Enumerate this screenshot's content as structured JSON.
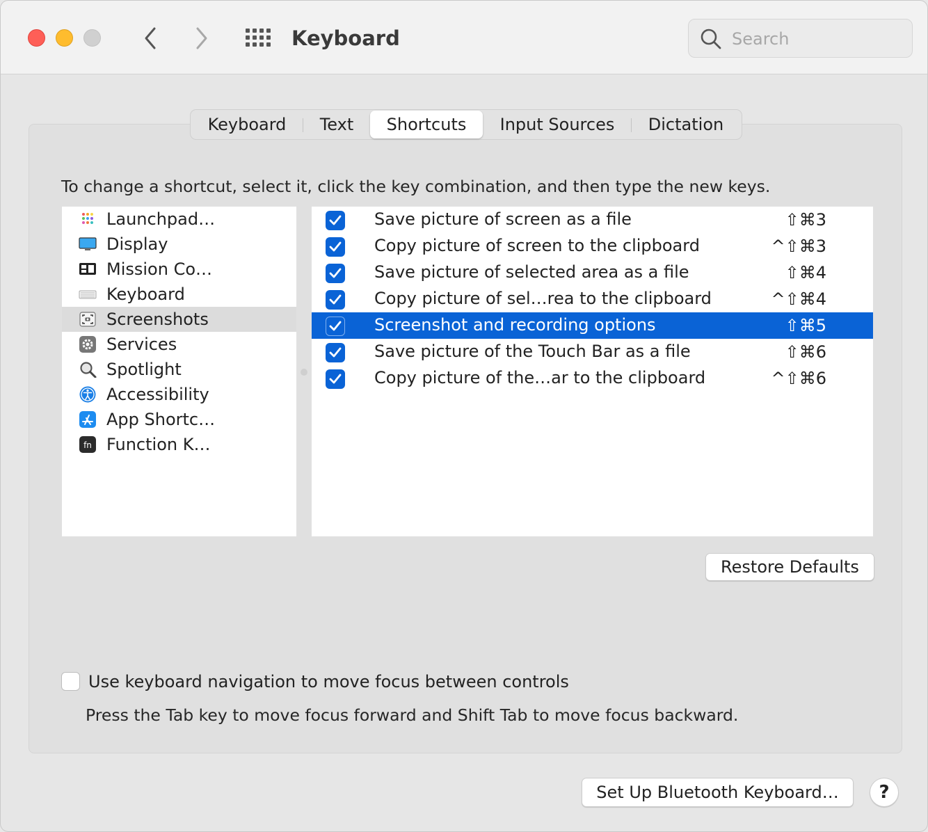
{
  "window": {
    "title": "Keyboard",
    "search_placeholder": "Search"
  },
  "tabs": [
    {
      "label": "Keyboard",
      "active": false
    },
    {
      "label": "Text",
      "active": false
    },
    {
      "label": "Shortcuts",
      "active": true
    },
    {
      "label": "Input Sources",
      "active": false
    },
    {
      "label": "Dictation",
      "active": false
    }
  ],
  "instructions": "To change a shortcut, select it, click the key combination, and then type the new keys.",
  "categories": [
    {
      "label": "Launchpad…",
      "icon": "launchpad-icon",
      "selected": false
    },
    {
      "label": "Display",
      "icon": "display-icon",
      "selected": false
    },
    {
      "label": "Mission Co…",
      "icon": "mission-control-icon",
      "selected": false
    },
    {
      "label": "Keyboard",
      "icon": "keyboard-icon",
      "selected": false
    },
    {
      "label": "Screenshots",
      "icon": "screenshot-icon",
      "selected": true
    },
    {
      "label": "Services",
      "icon": "gear-icon",
      "selected": false
    },
    {
      "label": "Spotlight",
      "icon": "magnifier-icon",
      "selected": false
    },
    {
      "label": "Accessibility",
      "icon": "accessibility-icon",
      "selected": false
    },
    {
      "label": "App Shortc…",
      "icon": "app-store-icon",
      "selected": false
    },
    {
      "label": "Function K…",
      "icon": "fn-key-icon",
      "selected": false
    }
  ],
  "shortcuts": [
    {
      "label": "Save picture of screen as a file",
      "keys": "⇧⌘3",
      "checked": true,
      "selected": false
    },
    {
      "label": "Copy picture of screen to the clipboard",
      "keys": "^⇧⌘3",
      "checked": true,
      "selected": false
    },
    {
      "label": "Save picture of selected area as a file",
      "keys": "⇧⌘4",
      "checked": true,
      "selected": false
    },
    {
      "label": "Copy picture of sel…rea to the clipboard",
      "keys": "^⇧⌘4",
      "checked": true,
      "selected": false
    },
    {
      "label": "Screenshot and recording options",
      "keys": "⇧⌘5",
      "checked": true,
      "selected": true
    },
    {
      "label": "Save picture of the Touch Bar as a file",
      "keys": "⇧⌘6",
      "checked": true,
      "selected": false
    },
    {
      "label": "Copy picture of the…ar to the clipboard",
      "keys": "^⇧⌘6",
      "checked": true,
      "selected": false
    }
  ],
  "buttons": {
    "restore_defaults": "Restore Defaults",
    "bluetooth": "Set Up Bluetooth Keyboard…",
    "help": "?"
  },
  "keyboard_navigation": {
    "label": "Use keyboard navigation to move focus between controls",
    "checked": false,
    "hint": "Press the Tab key to move focus forward and Shift Tab to move focus backward."
  },
  "colors": {
    "accent": "#0a63d6",
    "selection_gray": "#dcdcdc"
  }
}
